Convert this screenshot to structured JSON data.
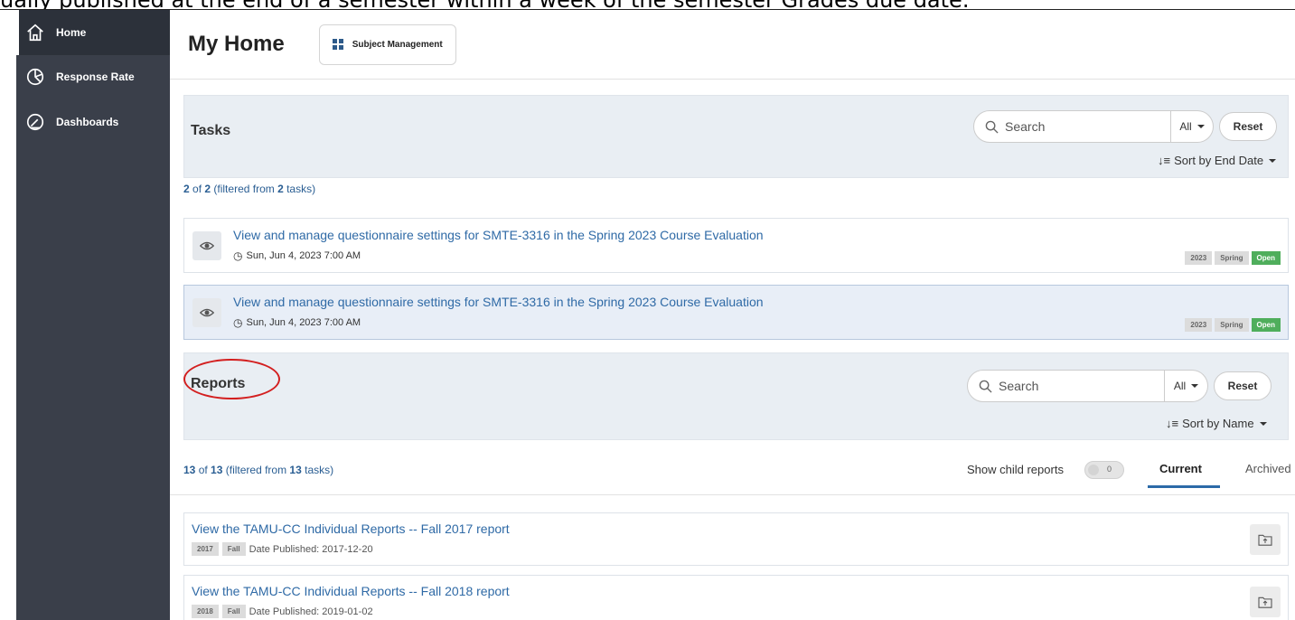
{
  "caption": "ually published at the end of a semester within a week of the semester Grades due date.",
  "colors": {
    "sidebar_bg": "#3a3f4a",
    "link": "#2f6aa6",
    "open_tag": "#4fae5c",
    "annotation": "#d31f1f"
  },
  "sidebar": {
    "items": [
      {
        "label": "Home",
        "icon": "home-icon"
      },
      {
        "label": "Response Rate",
        "icon": "pie-chart-icon"
      },
      {
        "label": "Dashboards",
        "icon": "gauge-icon"
      }
    ]
  },
  "header": {
    "title": "My Home",
    "subject_button": "Subject Management"
  },
  "tasks": {
    "title": "Tasks",
    "search_placeholder": "Search",
    "filter": "All",
    "reset": "Reset",
    "sort": "Sort by End Date",
    "count": {
      "shown": "2",
      "of": " of ",
      "total": "2",
      "prefix": " (filtered from ",
      "filtered": "2",
      "suffix": " tasks)"
    },
    "rows": [
      {
        "title": "View and manage questionnaire settings for SMTE-3316 in the Spring 2023 Course Evaluation",
        "date": "Sun, Jun 4, 2023 7:00 AM",
        "tags": [
          "2023",
          "Spring",
          "Open"
        ]
      },
      {
        "title": "View and manage questionnaire settings for SMTE-3316 in the Spring 2023 Course Evaluation",
        "date": "Sun, Jun 4, 2023 7:00 AM",
        "tags": [
          "2023",
          "Spring",
          "Open"
        ]
      }
    ]
  },
  "reports": {
    "title": "Reports",
    "search_placeholder": "Search",
    "filter": "All",
    "reset": "Reset",
    "sort": "Sort by Name",
    "count": {
      "shown": "13",
      "of": " of ",
      "total": "13",
      "prefix": " (filtered from ",
      "filtered": "13",
      "suffix": " tasks)"
    },
    "show_child_label": "Show child reports",
    "child_toggle_value": "0",
    "tabs": [
      "Current",
      "Archived"
    ],
    "rows": [
      {
        "title": "View the TAMU-CC Individual Reports -- Fall 2017 report",
        "year": "2017",
        "term": "Fall",
        "published": "Date Published: 2017-12-20"
      },
      {
        "title": "View the TAMU-CC Individual Reports -- Fall 2018 report",
        "year": "2018",
        "term": "Fall",
        "published": "Date Published: 2019-01-02"
      }
    ]
  }
}
